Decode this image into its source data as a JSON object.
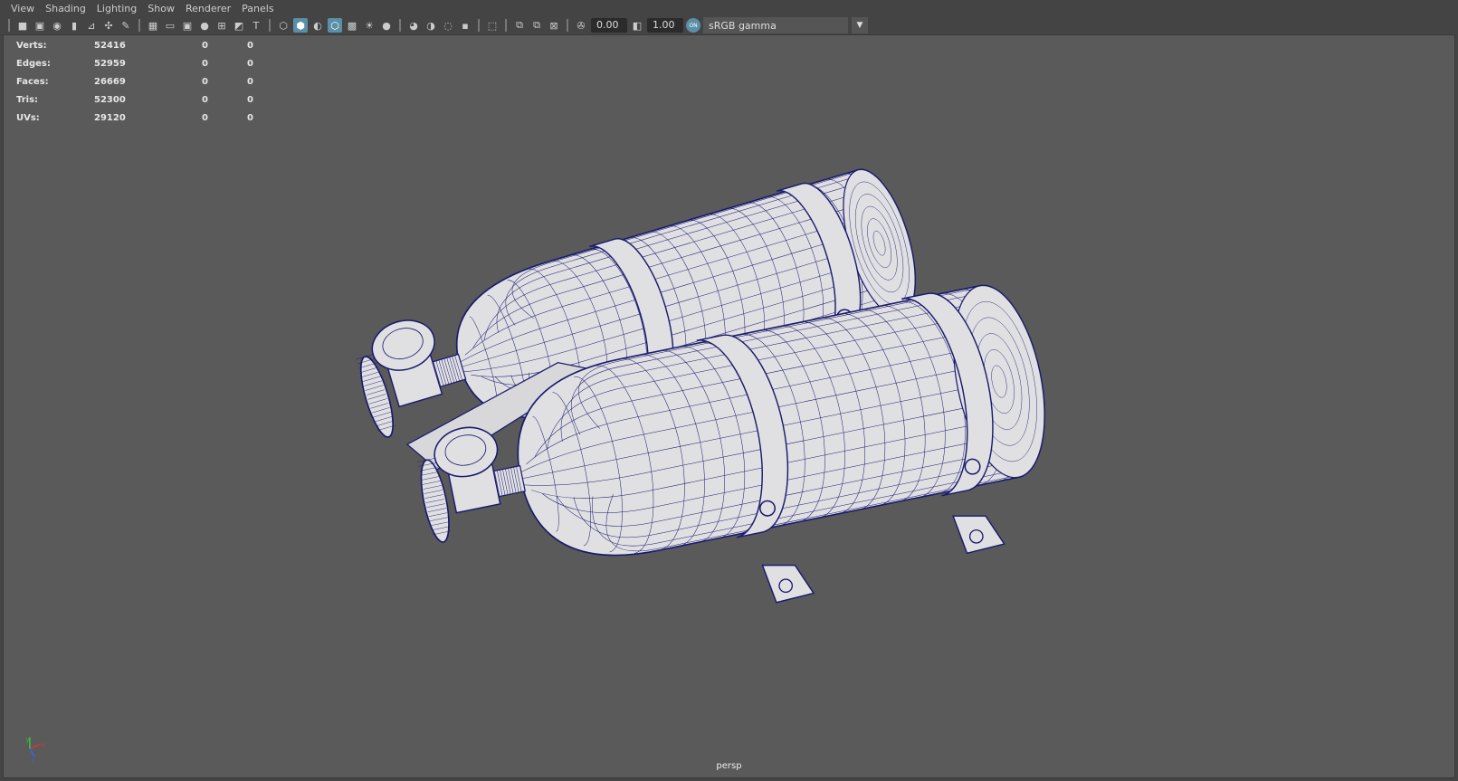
{
  "menu": [
    "View",
    "Shading",
    "Lighting",
    "Show",
    "Renderer",
    "Panels"
  ],
  "toolbar": {
    "exposure": "0.00",
    "gamma": "1.00",
    "color_space": "sRGB gamma",
    "cm_badge": "ON"
  },
  "stats": [
    {
      "label": "Verts:",
      "v1": "52416",
      "v2": "0",
      "v3": "0"
    },
    {
      "label": "Edges:",
      "v1": "52959",
      "v2": "0",
      "v3": "0"
    },
    {
      "label": "Faces:",
      "v1": "26669",
      "v2": "0",
      "v3": "0"
    },
    {
      "label": "Tris:",
      "v1": "52300",
      "v2": "0",
      "v3": "0"
    },
    {
      "label": "UVs:",
      "v1": "29120",
      "v2": "0",
      "v3": "0"
    }
  ],
  "camera": "persp",
  "axis": {
    "x": "x",
    "y": "y",
    "z": "z"
  },
  "colors": {
    "wire": "#1a1a6e",
    "surface": "#e0e0e2",
    "viewport": "#5a5a5a"
  }
}
